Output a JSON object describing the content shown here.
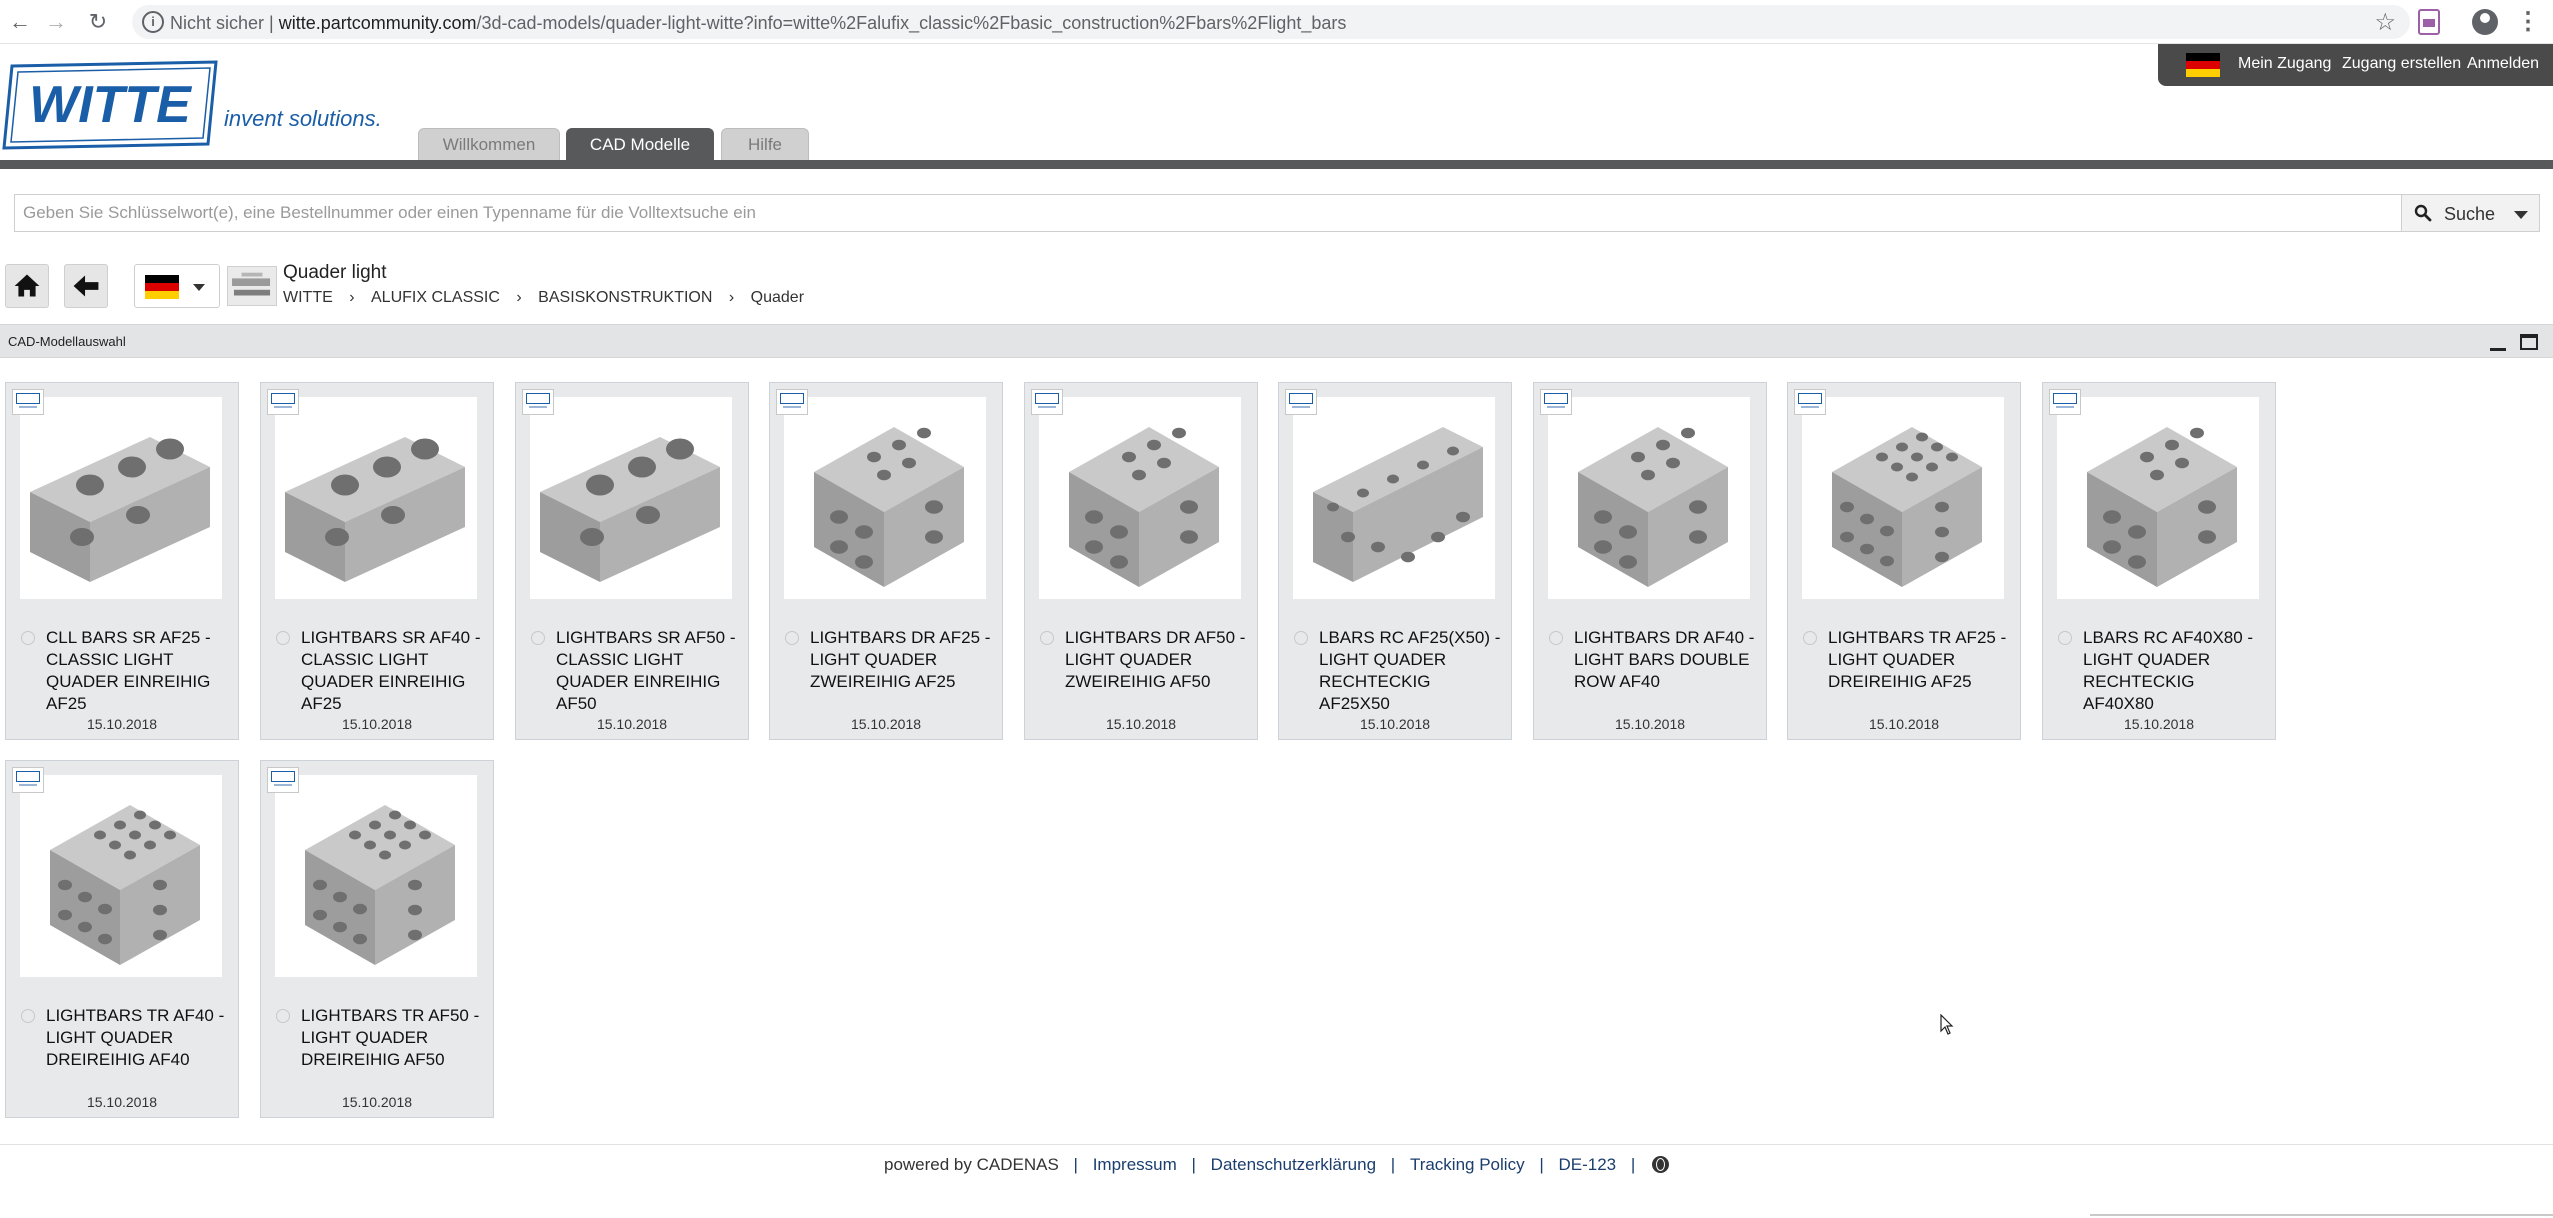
{
  "browser": {
    "security_label": "Nicht sicher",
    "url_host": "witte.partcommunity.com",
    "url_path": "/3d-cad-models/quader-light-witte?info=witte%2Falufix_classic%2Fbasic_construction%2Fbars%2Flight_bars"
  },
  "header": {
    "logo_alt": "WITTE",
    "slogan": "invent solutions.",
    "tabs": [
      {
        "label": "Willkommen",
        "active": false
      },
      {
        "label": "CAD Modelle",
        "active": true
      },
      {
        "label": "Hilfe",
        "active": false
      }
    ],
    "user_menu": {
      "account": "Mein Zugang",
      "register": "Zugang erstellen",
      "login": "Anmelden"
    },
    "colors": {
      "band": "#58595b",
      "brand": "#1b5ea8"
    }
  },
  "search": {
    "placeholder": "Geben Sie Schlüsselwort(e), eine Bestellnummer oder einen Typenname für die Volltextsuche ein",
    "button_label": "Suche"
  },
  "breadcrumb": {
    "title": "Quader light",
    "items": [
      "WITTE",
      "ALUFIX CLASSIC",
      "BASISKONSTRUKTION",
      "Quader"
    ]
  },
  "panel": {
    "title": "CAD-Modellauswahl"
  },
  "products": [
    {
      "name": "CLL BARS SR AF25 - CLASSIC LIGHT QUADER EINREIHIG AF25",
      "date": "15.10.2018"
    },
    {
      "name": "LIGHTBARS SR AF40 - CLASSIC LIGHT QUADER EINREIHIG AF25",
      "date": "15.10.2018"
    },
    {
      "name": "LIGHTBARS SR AF50 - CLASSIC LIGHT QUADER EINREIHIG AF50",
      "date": "15.10.2018"
    },
    {
      "name": "LIGHTBARS DR AF25 - LIGHT QUADER ZWEIREIHIG AF25",
      "date": "15.10.2018"
    },
    {
      "name": "LIGHTBARS DR AF50 - LIGHT QUADER ZWEIREIHIG AF50",
      "date": "15.10.2018"
    },
    {
      "name": "LBARS RC AF25(X50) - LIGHT QUADER RECHTECKIG AF25X50",
      "date": "15.10.2018"
    },
    {
      "name": "LIGHTBARS DR AF40 - LIGHT BARS DOUBLE ROW AF40",
      "date": "15.10.2018"
    },
    {
      "name": "LIGHTBARS TR AF25 - LIGHT QUADER DREIREIHIG AF25",
      "date": "15.10.2018"
    },
    {
      "name": "LBARS RC AF40X80 - LIGHT QUADER RECHTECKIG AF40X80",
      "date": "15.10.2018"
    },
    {
      "name": "LIGHTBARS TR AF40 - LIGHT QUADER DREIREIHIG AF40",
      "date": "15.10.2018"
    },
    {
      "name": "LIGHTBARS TR AF50 - LIGHT QUADER DREIREIHIG AF50",
      "date": "15.10.2018"
    }
  ],
  "footer": {
    "powered_by": "powered by CADENAS",
    "imprint": "Impressum",
    "privacy": "Datenschutzerklärung",
    "tracking": "Tracking Policy",
    "code": "DE-123"
  }
}
